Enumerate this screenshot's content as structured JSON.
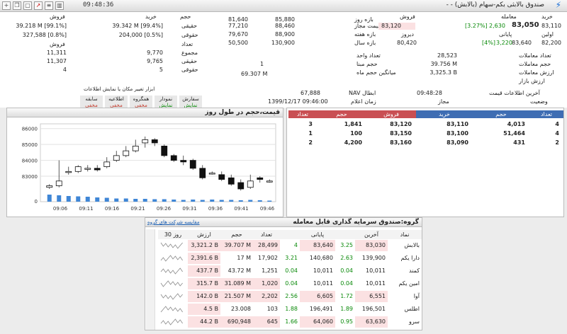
{
  "titlebar": {
    "time": "09:48:36",
    "title": "صندوق بالابثی بکم-سهام (بالابش) - -",
    "icons": [
      "add-icon",
      "copy-icon",
      "window-icon",
      "chart-icon",
      "list-icon",
      "bar-chart-icon"
    ]
  },
  "info": {
    "left_headers": {
      "buy": "خرید",
      "volume": "حجم",
      "sell": "فروش"
    },
    "left_rows": [
      {
        "sell": "39.218 M [99.1%]",
        "buy": "39.342 M [99.4%]",
        "label": "حقیقی"
      },
      {
        "sell": "327,588 [0.8%]",
        "buy": "204,000 [0.5%]",
        "label": "حقوقی"
      },
      {
        "sell_label": "فروش",
        "label": "تعداد"
      },
      {
        "sell": "11,311",
        "buy": "9,770",
        "label": "مجموع"
      },
      {
        "sell": "11,307",
        "buy": "9,765",
        "label": "حقیقی"
      },
      {
        "sell": "4",
        "buy": "5",
        "label": "حقوقی"
      }
    ],
    "range_rows": [
      {
        "label": "بازه روز",
        "low": "81,640",
        "high": "85,880"
      },
      {
        "label": "قیمت مجاز",
        "low": "77,210",
        "high": "88,460"
      },
      {
        "label": "بازه هفته",
        "low": "79,670",
        "high": "88,900"
      },
      {
        "label": "بازه سال",
        "low": "50,500",
        "high": "130,900"
      }
    ],
    "right_headers": {
      "trade": "معامله",
      "sell": "فروش",
      "buy": "خرید"
    },
    "last_price_label": "آخرین",
    "last_trade": "83,050",
    "last_change": "2,630",
    "last_change_pct": "[3.27%]",
    "sell_price": "83,120",
    "closing_label": "پایانی",
    "closing": "83,640",
    "closing_change": "3,220",
    "closing_pct": "[4%]",
    "prev_label": "دیروز",
    "prev": "80,420",
    "first_label": "اولین",
    "first": "82,200",
    "open_price": "83,110",
    "stats": [
      {
        "label": "تعداد معاملات",
        "value": "28,523"
      },
      {
        "label": "حجم معاملات",
        "value": "39.756 M"
      },
      {
        "label": "ارزش معاملات",
        "value": "3,325.3 B"
      },
      {
        "label": "ارزش بازار",
        "value": ""
      }
    ],
    "stats_left": [
      {
        "label": "تعداد واحد",
        "value": ""
      },
      {
        "label": "حجم مبنا",
        "value": "1"
      },
      {
        "label": "میانگین حجم ماه",
        "value": "69.307 M"
      }
    ],
    "last_info_label": "آخرین اطلاعات قیمت",
    "last_info_time": "09:48:28",
    "status_label": "وضعیت",
    "status_value": "مجاز",
    "nav_label": "NAV ابطال",
    "nav_value": "67,888",
    "announce_label": "زمان اعلام",
    "announce_value": "1399/12/17 09:46:00",
    "tools_label": "ابزار تغییر مکان یا نمایش اطلاعات",
    "buttons": [
      {
        "top": "سفارش",
        "bottom": "نمایش"
      },
      {
        "top": "نمودار",
        "bottom": "نمایش"
      },
      {
        "top": "همگروه",
        "bottom": "مخفی"
      },
      {
        "top": "اطلاعیه",
        "bottom": "مخفی"
      },
      {
        "top": "سابقه",
        "bottom": "مخفی"
      }
    ]
  },
  "chart_panel": {
    "title": "قیمت،حجم در طول روز"
  },
  "chart_data": {
    "type": "candlestick",
    "title": "قیمت،حجم در طول روز",
    "y_ticks": [
      83000,
      84000,
      85000,
      86000
    ],
    "ylim": [
      82200,
      86300
    ],
    "x_ticks": [
      "09:06",
      "09:11",
      "09:16",
      "09:21",
      "09:26",
      "09:31",
      "09:36",
      "09:41",
      "09:46"
    ],
    "volume_zero_label": "0",
    "candles": [
      {
        "o": 82300,
        "c": 82400,
        "h": 82500,
        "l": 82200,
        "v": 1.0
      },
      {
        "o": 82400,
        "c": 82700,
        "h": 84000,
        "l": 82300,
        "v": 0.9
      },
      {
        "o": 83300,
        "c": 83300,
        "h": 83600,
        "l": 83100,
        "v": 0.8
      },
      {
        "o": 83300,
        "c": 83600,
        "h": 83700,
        "l": 83200,
        "v": 0.75
      },
      {
        "o": 83500,
        "c": 83500,
        "h": 83700,
        "l": 83300,
        "v": 0.7
      },
      {
        "o": 83500,
        "c": 83400,
        "h": 83700,
        "l": 83300,
        "v": 0.6
      },
      {
        "o": 83600,
        "c": 83900,
        "h": 84200,
        "l": 83500,
        "v": 0.55
      },
      {
        "o": 84000,
        "c": 84300,
        "h": 84600,
        "l": 83900,
        "v": 0.45
      },
      {
        "o": 84300,
        "c": 84600,
        "h": 84900,
        "l": 84200,
        "v": 0.45
      },
      {
        "o": 84600,
        "c": 84900,
        "h": 85300,
        "l": 84500,
        "v": 0.4
      },
      {
        "o": 85100,
        "c": 85300,
        "h": 85500,
        "l": 84800,
        "v": 0.4
      },
      {
        "o": 85300,
        "c": 85100,
        "h": 85400,
        "l": 84900,
        "v": 0.35
      },
      {
        "o": 84900,
        "c": 84300,
        "h": 85000,
        "l": 84200,
        "v": 0.35
      },
      {
        "o": 84300,
        "c": 84000,
        "h": 84400,
        "l": 83900,
        "v": 0.3
      },
      {
        "o": 84000,
        "c": 83900,
        "h": 84300,
        "l": 83700,
        "v": 0.25
      },
      {
        "o": 84000,
        "c": 83500,
        "h": 84100,
        "l": 83400,
        "v": 0.3
      },
      {
        "o": 83500,
        "c": 82900,
        "h": 83700,
        "l": 82800,
        "v": 0.25
      },
      {
        "o": 83200,
        "c": 83200,
        "h": 83300,
        "l": 83100,
        "v": 0.3
      },
      {
        "o": 83100,
        "c": 82800,
        "h": 83300,
        "l": 82700,
        "v": 0.25
      },
      {
        "o": 82900,
        "c": 82500,
        "h": 83100,
        "l": 82400,
        "v": 0.25
      },
      {
        "o": 82600,
        "c": 82200,
        "h": 82800,
        "l": 82100,
        "v": 0.2
      },
      {
        "o": 82300,
        "c": 82700,
        "h": 83100,
        "l": 82200,
        "v": 0.25
      },
      {
        "o": 82900,
        "c": 82800,
        "h": 83000,
        "l": 82600,
        "v": 0.2
      },
      {
        "o": 82700,
        "c": 82700,
        "h": 82800,
        "l": 82600,
        "v": 0.15
      }
    ]
  },
  "orderbook": {
    "headers": [
      "تعداد",
      "حجم",
      "خرید",
      "فروش",
      "حجم",
      "تعداد"
    ],
    "rows": [
      {
        "buy_count": "4",
        "buy_vol": "4,013",
        "buy_price": "83,110",
        "sell_price": "83,120",
        "sell_vol": "1,841",
        "sell_count": "3"
      },
      {
        "buy_count": "4",
        "buy_vol": "51,464",
        "buy_price": "83,100",
        "sell_price": "83,150",
        "sell_vol": "100",
        "sell_count": "1"
      },
      {
        "buy_count": "2",
        "buy_vol": "431",
        "buy_price": "83,090",
        "sell_price": "83,160",
        "sell_vol": "4,200",
        "sell_count": "2"
      }
    ]
  },
  "group": {
    "title": "گروه:صندوق سرمایه گذاری قابل معامله",
    "link": "مقایسه شرکت های گروه",
    "headers": [
      "نماد",
      "آخرین",
      "",
      "پایانی",
      "",
      "تعداد",
      "حجم",
      "ارزش",
      "30 روز"
    ],
    "rows": [
      {
        "sym": "بالابش",
        "last": "83,030",
        "lchg": "3.25",
        "close": "83,640",
        "cchg": "4",
        "count": "28,499",
        "vol": "39.707 M",
        "val": "3,321.2 B",
        "hl": true
      },
      {
        "sym": "دارا یکم",
        "last": "139,900",
        "lchg": "2.63",
        "close": "140,680",
        "cchg": "3.21",
        "count": "17,902",
        "vol": "17 M",
        "val": "2,391.6 B",
        "hl": false
      },
      {
        "sym": "کمند",
        "last": "10,011",
        "lchg": "0.04",
        "close": "10,011",
        "cchg": "0.04",
        "count": "1,251",
        "vol": "43.72 M",
        "val": "437.7 B",
        "hl": false
      },
      {
        "sym": "امین یکم",
        "last": "10,011",
        "lchg": "0.04",
        "close": "10,011",
        "cchg": "0.04",
        "count": "1,020",
        "vol": "31.089 M",
        "val": "315.7 B",
        "hl": false
      },
      {
        "sym": "آوا",
        "last": "6,551",
        "lchg": "1.72",
        "close": "6,605",
        "cchg": "2.56",
        "count": "2,202",
        "vol": "21.507 M",
        "val": "142.0 B",
        "hl": true
      },
      {
        "sym": "اطلس",
        "last": "196,501",
        "lchg": "1.89",
        "close": "196,491",
        "cchg": "1.88",
        "count": "103",
        "vol": "23.008",
        "val": "4.5 B",
        "hl": false
      },
      {
        "sym": "سرو",
        "last": "63,630",
        "lchg": "0.95",
        "close": "64,060",
        "cchg": "1.66",
        "count": "645",
        "vol": "690,948",
        "val": "44.2 B",
        "hl": true
      }
    ]
  }
}
